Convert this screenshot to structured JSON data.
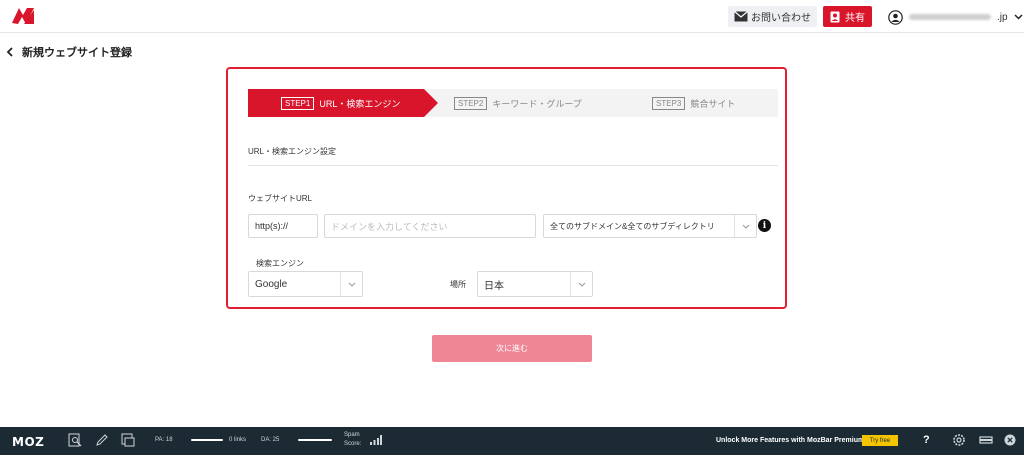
{
  "header": {
    "contact_label": "お問い合わせ",
    "share_label": "共有",
    "user_email_suffix": ".jp"
  },
  "page": {
    "back_title": "新規ウェブサイト登録"
  },
  "steps": [
    {
      "tag": "STEP1",
      "label": "URL・検索エンジン",
      "active": true
    },
    {
      "tag": "STEP2",
      "label": "キーワード・グループ",
      "active": false
    },
    {
      "tag": "STEP3",
      "label": "競合サイト",
      "active": false
    }
  ],
  "form": {
    "section_title": "URL・検索エンジン設定",
    "website_url_label": "ウェブサイトURL",
    "protocol_value": "http(s)://",
    "domain_placeholder": "ドメインを入力してください",
    "scope_value": "全てのサブドメイン&全てのサブディレクトリ",
    "engine_label": "検索エンジン",
    "engine_value": "Google",
    "location_label": "場所",
    "location_value": "日本"
  },
  "next_button_label": "次に進む",
  "mozbar": {
    "logo": "MOZ",
    "pa_label": "PA: 18",
    "links_label": "0 links",
    "da_label": "DA: 25",
    "spam_label_1": "Spam",
    "spam_label_2": "Score:",
    "premium_text": "Unlock More Features with MozBar Premium",
    "try_label": "Try free",
    "help_label": "?"
  },
  "colors": {
    "accent": "#d9152b",
    "panel_border": "#e02030",
    "next_button": "#ef8695",
    "mozbar_bg": "#1c2b33",
    "try_button": "#f5c400"
  }
}
